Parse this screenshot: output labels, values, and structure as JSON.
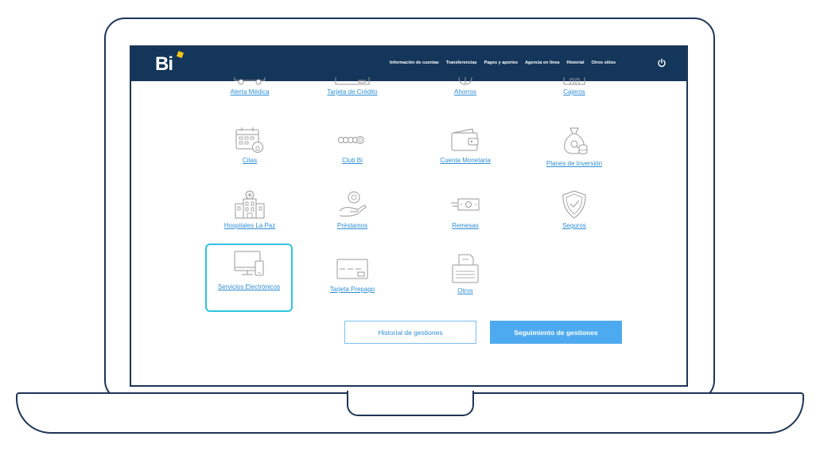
{
  "app": {
    "logo_text": "Bi",
    "accent_yellow": "#f5c518",
    "header_color": "#14365a",
    "link_color": "#2e8fd6",
    "highlight_color": "#2ec4e0"
  },
  "nav": {
    "items": [
      "Información de cuentas",
      "Transferencias",
      "Pagos y aportes",
      "Agencia en línea",
      "Historial",
      "Otros sitios"
    ],
    "power_icon": "power-icon"
  },
  "tiles": {
    "row0": [
      "Alerta Médica",
      "Tarjeta de Crédito",
      "Ahorros",
      "Cajeros"
    ],
    "row1": [
      "Citas",
      "Club Bi",
      "Cuenta Monetaria",
      "Planes de Inversión"
    ],
    "row2": [
      "Hospitales La Paz",
      "Préstamos",
      "Remesas",
      "Seguros"
    ],
    "row3": [
      "Servicios Electrónicos",
      "Tarjeta Prepago",
      "Otros"
    ],
    "selected": "Servicios Electrónicos"
  },
  "buttons": {
    "history_label": "Historial de gestiones",
    "tracking_label": "Seguimiento de gestiones"
  }
}
